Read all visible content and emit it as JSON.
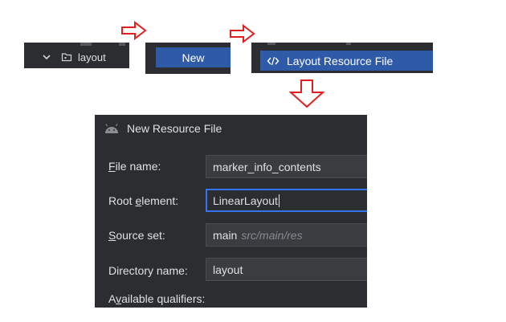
{
  "tree": {
    "folder_label": "layout",
    "chevron_icon": "chevron-down-icon",
    "folder_icon": "folder-icon"
  },
  "menu": {
    "new_label": "New"
  },
  "submenu": {
    "layout_resource_label": "Layout Resource File",
    "icon": "xml-code-icon"
  },
  "dialog": {
    "title": "New Resource File",
    "icon": "android-icon",
    "fields": {
      "file_name": {
        "label_pre": "",
        "label_mn": "F",
        "label_post": "ile name:",
        "value": "marker_info_contents"
      },
      "root_element": {
        "label_pre": "Root ",
        "label_mn": "e",
        "label_post": "lement:",
        "value": "LinearLayout"
      },
      "source_set": {
        "label_pre": "",
        "label_mn": "S",
        "label_post": "ource set:",
        "value": "main",
        "hint": "src/main/res"
      },
      "directory_name": {
        "label_pre": "Directory name:",
        "label_mn": "",
        "label_post": "",
        "value": "layout"
      },
      "qualifiers": {
        "label_pre": "A",
        "label_mn": "v",
        "label_post": "ailable qualifiers:"
      }
    }
  },
  "colors": {
    "arrow": "#e02020",
    "panel_bg": "#2b2d30",
    "selection": "#2e5aa7",
    "focus": "#3574f0"
  }
}
